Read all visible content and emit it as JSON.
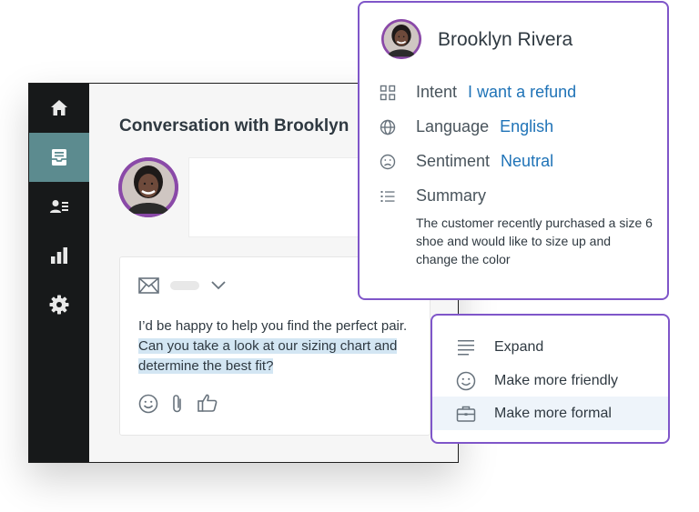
{
  "conversation": {
    "title": "Conversation with Brooklyn"
  },
  "sidebar": {
    "items": [
      {
        "icon": "home-icon",
        "active": false
      },
      {
        "icon": "inbox-icon",
        "active": true
      },
      {
        "icon": "contacts-icon",
        "active": false
      },
      {
        "icon": "reports-icon",
        "active": false
      },
      {
        "icon": "settings-icon",
        "active": false
      }
    ]
  },
  "composer": {
    "reply_plain": "I’d be happy to help you find the perfect pair. ",
    "reply_highlighted": "Can you take a look at our sizing chart and determine the best fit?",
    "icons": [
      "mail-icon",
      "chevron-down-icon",
      "emoji-icon",
      "attachment-icon",
      "thumbs-up-icon"
    ]
  },
  "customer": {
    "name": "Brooklyn Rivera",
    "fields": [
      {
        "label": "Intent",
        "value": "I want a refund",
        "icon": "grid-icon"
      },
      {
        "label": "Language",
        "value": "English",
        "icon": "globe-icon"
      },
      {
        "label": "Sentiment",
        "value": "Neutral",
        "icon": "sad-face-icon"
      }
    ],
    "summary_label": "Summary",
    "summary_text": "The customer recently purchased a size 6 shoe and would like to size up and change the color"
  },
  "ai_actions": {
    "items": [
      {
        "label": "Expand",
        "icon": "lines-icon",
        "selected": false
      },
      {
        "label": "Make more friendly",
        "icon": "smile-icon",
        "selected": false
      },
      {
        "label": "Make more formal",
        "icon": "briefcase-icon",
        "selected": true
      }
    ]
  },
  "colors": {
    "accent_purple": "#7f56c9",
    "link_blue": "#1f73b7",
    "sidebar_bg": "#17191a",
    "sidebar_active": "#5c8b8f",
    "highlight": "#d3e6f3"
  }
}
